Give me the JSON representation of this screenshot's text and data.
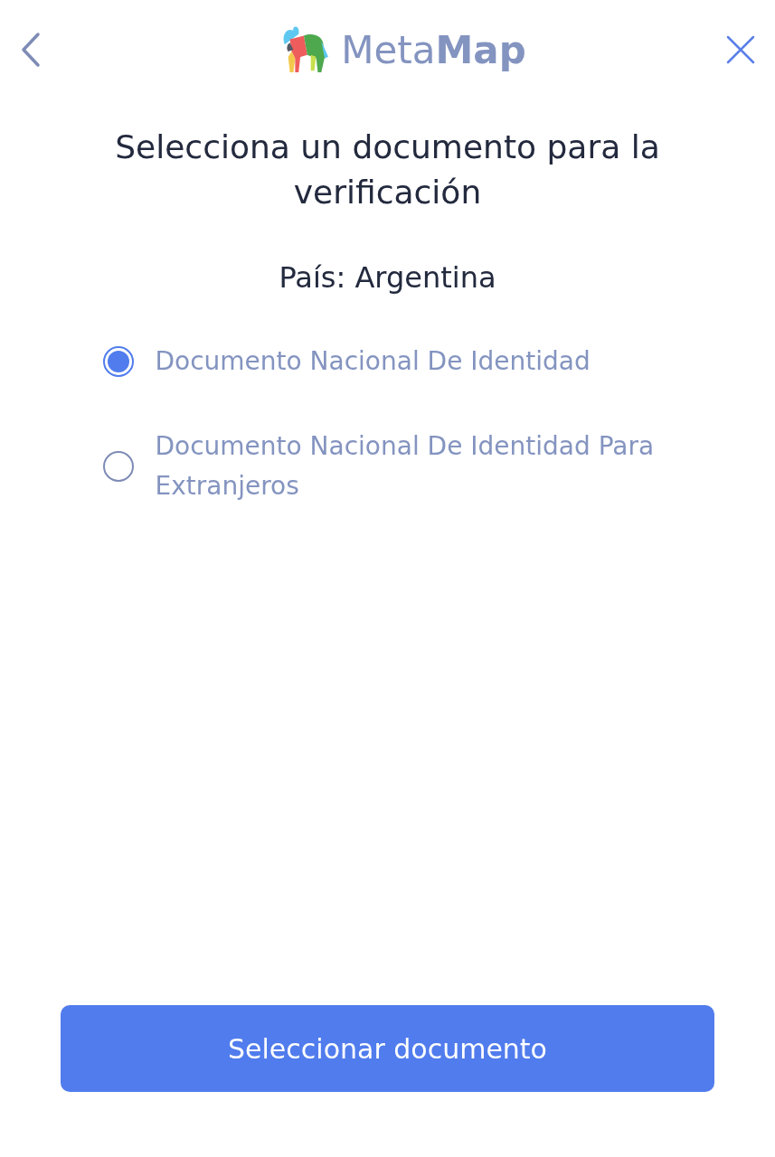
{
  "header": {
    "logo_text": "Meta**Map**"
  },
  "title": "Selecciona un documento para la verificación",
  "country": "País: Argentina",
  "options": [
    {
      "label": "Documento Nacional De Identidad",
      "selected": true
    },
    {
      "label": "Documento Nacional De Identidad Para Extranjeros",
      "selected": false
    }
  ],
  "button": "Seleccionar documento"
}
